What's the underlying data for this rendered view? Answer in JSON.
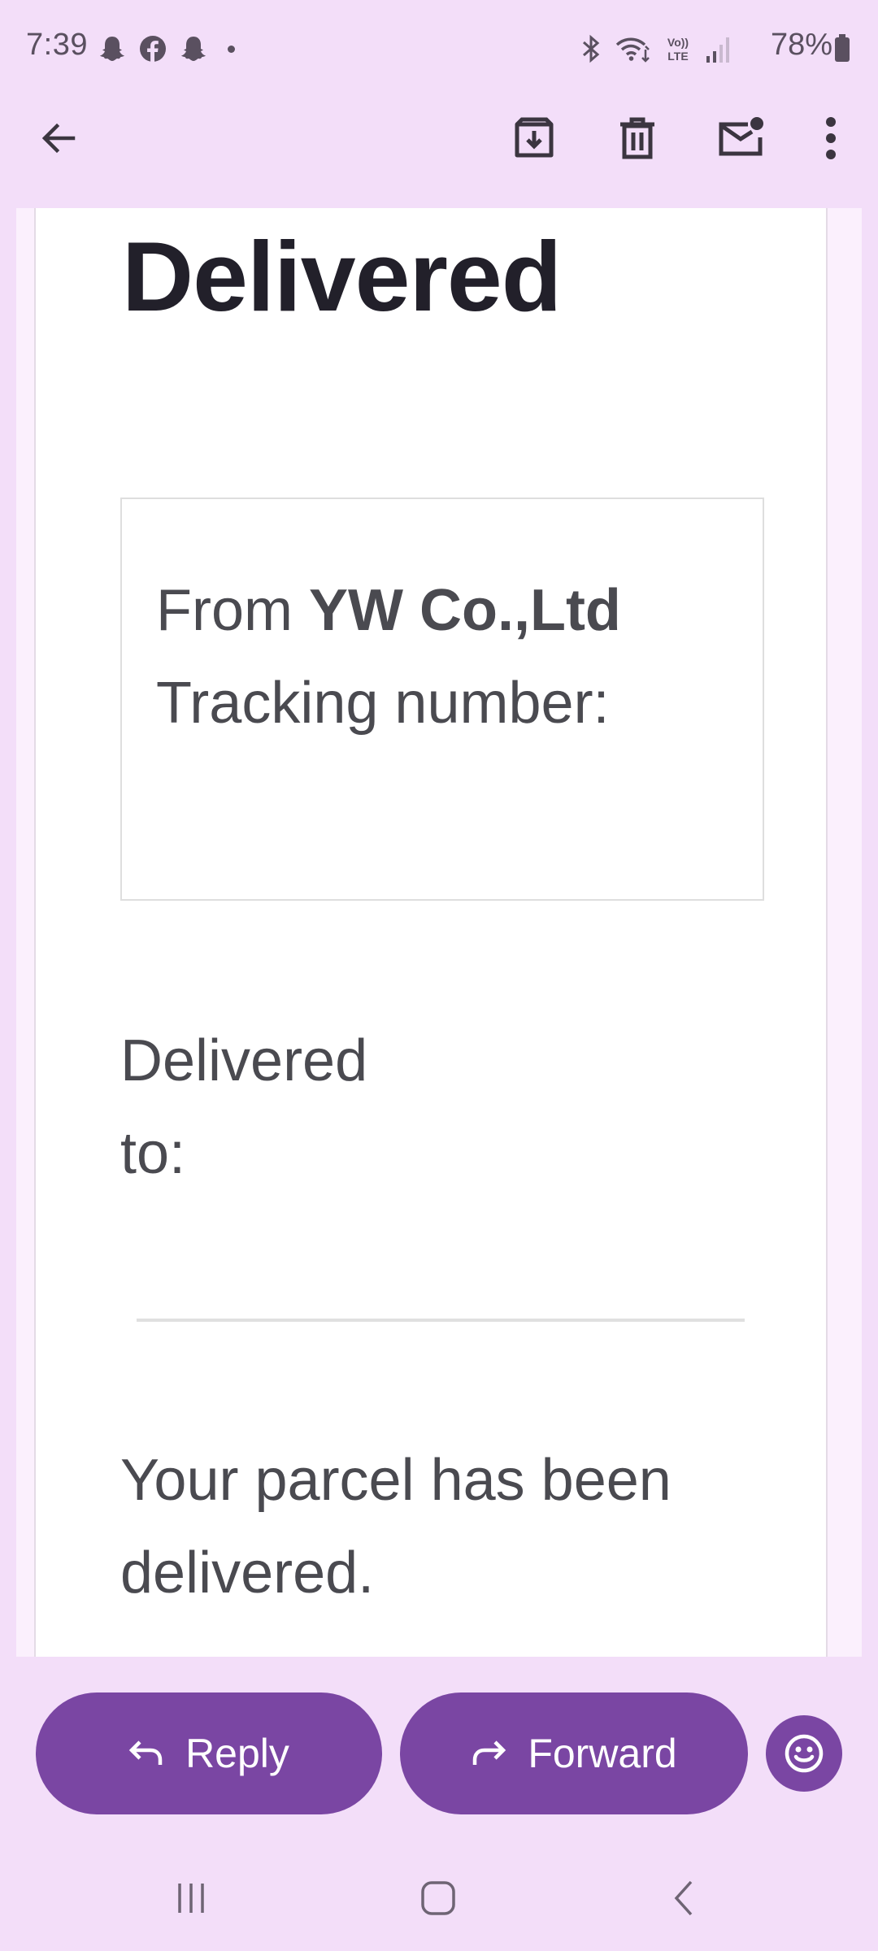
{
  "status_bar": {
    "time": "7:39",
    "battery_percent": "78%",
    "left_icons": [
      "snapchat-icon",
      "facebook-icon",
      "snapchat-icon"
    ],
    "right_icons": [
      "bluetooth-icon",
      "wifi-icon",
      "volte-icon",
      "signal-icon",
      "battery-icon"
    ],
    "volte_label": "Vo)) LTE"
  },
  "app_bar": {
    "actions": [
      "back-arrow-icon",
      "archive-icon",
      "delete-icon",
      "mark-unread-icon",
      "more-vert-icon"
    ]
  },
  "email": {
    "heading": "Delivered",
    "from_prefix": "From",
    "sender": "YW Co.,Ltd",
    "tracking_label": "Tracking number:",
    "delivered_to_line1": "Delivered",
    "delivered_to_line2": "to:",
    "message_line1": "Your parcel has been",
    "message_line2": "delivered."
  },
  "actions": {
    "reply_label": "Reply",
    "forward_label": "Forward"
  },
  "colors": {
    "background": "#f3def9",
    "accent": "#7a46a3",
    "heading_text": "#22202a",
    "body_text": "#4a4a50"
  }
}
